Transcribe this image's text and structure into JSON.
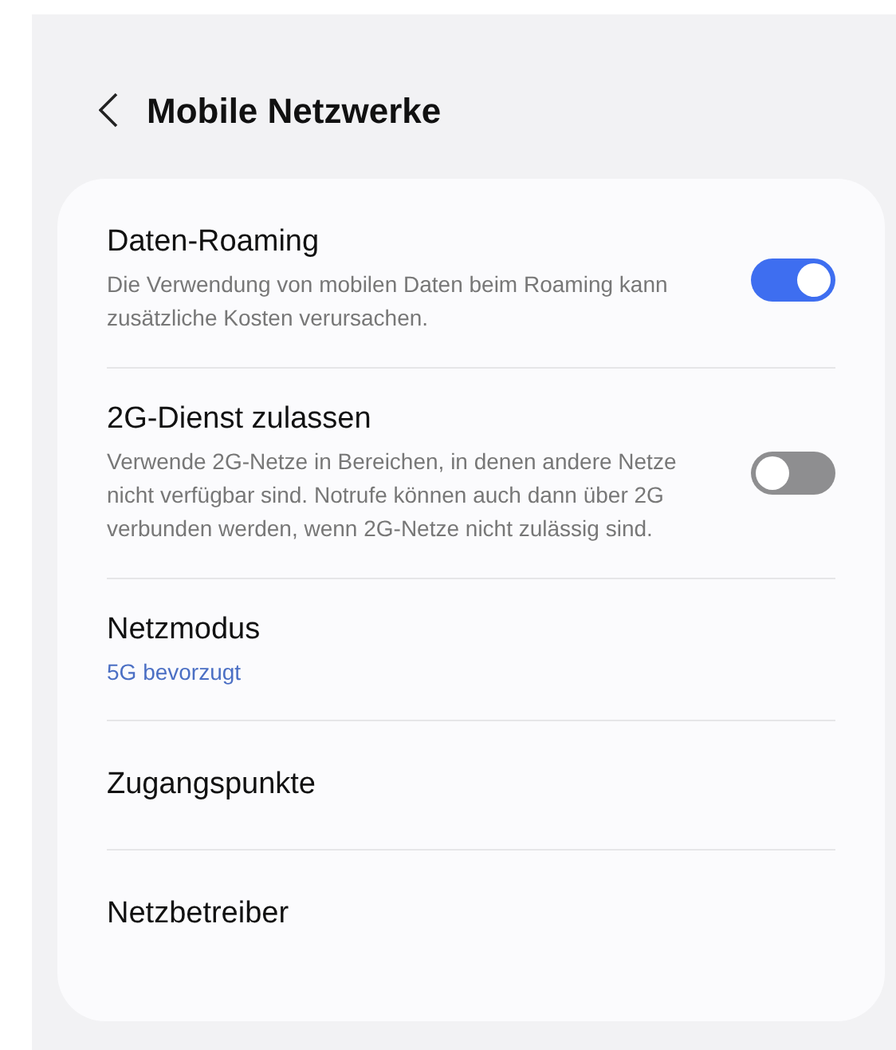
{
  "header": {
    "title": "Mobile Netzwerke"
  },
  "items": [
    {
      "kind": "toggle",
      "title": "Daten-Roaming",
      "subtitle": "Die Verwendung von mobilen Daten beim Roaming kann zusätzliche Kosten verursachen.",
      "on": true
    },
    {
      "kind": "toggle",
      "title": "2G-Dienst zulassen",
      "subtitle": "Verwende 2G-Netze in Bereichen, in denen andere Netze nicht verfügbar sind. Notrufe können auch dann über 2G verbunden werden, wenn 2G-Netze nicht zulässig sind.",
      "on": false
    },
    {
      "kind": "value",
      "title": "Netzmodus",
      "value": "5G bevorzugt"
    },
    {
      "kind": "link",
      "title": "Zugangspunkte"
    },
    {
      "kind": "link",
      "title": "Netzbetreiber"
    }
  ]
}
